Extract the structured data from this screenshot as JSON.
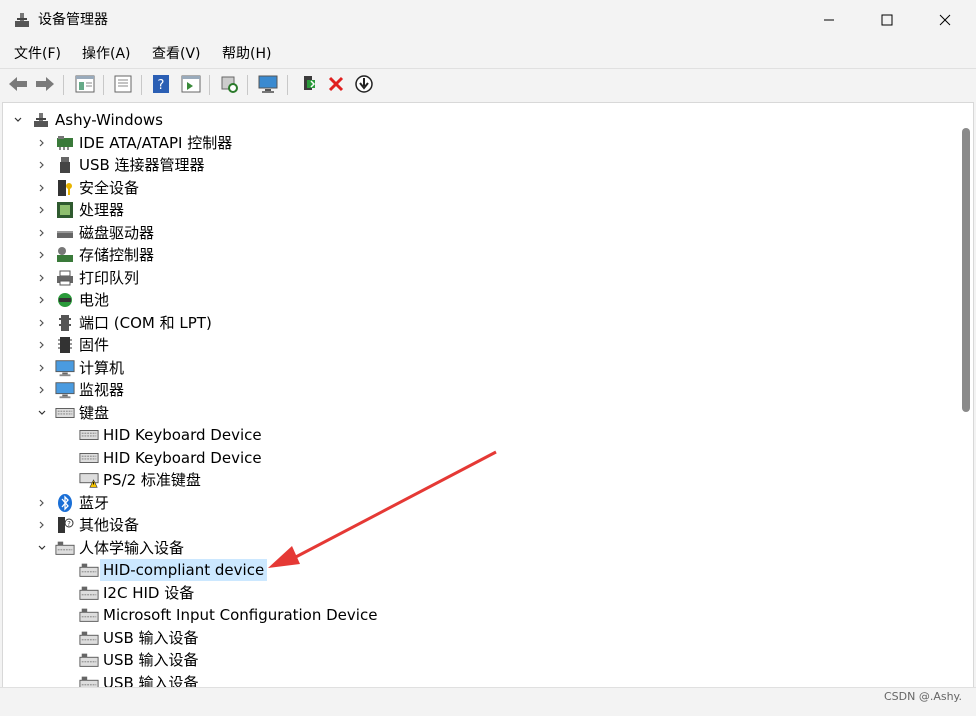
{
  "window": {
    "title": "设备管理器"
  },
  "menu": [
    "文件(F)",
    "操作(A)",
    "查看(V)",
    "帮助(H)"
  ],
  "toolbar": [
    "back-icon",
    "forward-icon",
    "properties-icon",
    "show-hide-icon",
    "help-icon",
    "action-pane-icon",
    "scan-icon",
    "monitor-icon",
    "add-driver-icon",
    "uninstall-icon",
    "update-icon"
  ],
  "tree": {
    "root": "Ashy-Windows",
    "cats": [
      "IDE ATA/ATAPI 控制器",
      "USB 连接器管理器",
      "安全设备",
      "处理器",
      "磁盘驱动器",
      "存储控制器",
      "打印队列",
      "电池",
      "端口 (COM 和 LPT)",
      "固件",
      "计算机",
      "监视器",
      "键盘",
      "蓝牙",
      "其他设备",
      "人体学输入设备"
    ],
    "keyboard_children": [
      "HID Keyboard Device",
      "HID Keyboard Device",
      "PS/2 标准键盘"
    ],
    "hid_children": [
      "HID-compliant device",
      "I2C HID 设备",
      "Microsoft Input Configuration Device",
      "USB 输入设备",
      "USB 输入设备",
      "USB 输入设备"
    ]
  },
  "watermark": "CSDN @.Ashy.",
  "colors": {
    "selection": "#cce8ff",
    "arrow": "#e53935"
  }
}
